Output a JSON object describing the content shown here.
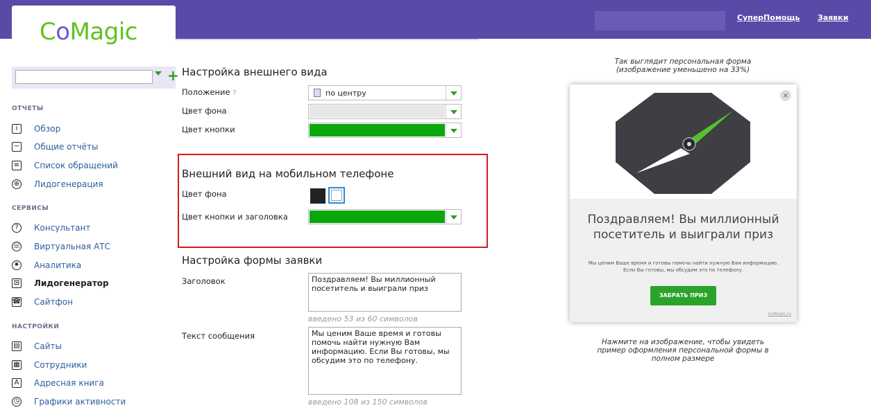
{
  "header": {
    "logo": "CoMagic",
    "links": {
      "help": "СуперПомощь",
      "apps": "Заявки",
      "more": ""
    }
  },
  "sidebar": {
    "search_value": "",
    "sections": [
      {
        "title": "ОТЧЕТЫ",
        "items": [
          "Обзор",
          "Общие отчёты",
          "Список обращений",
          "Лидогенерация"
        ]
      },
      {
        "title": "СЕРВИСЫ",
        "items": [
          "Консультант",
          "Виртуальная АТС",
          "Аналитика",
          "Лидогенератор",
          "Сайтфон"
        ]
      },
      {
        "title": "НАСТРОЙКИ",
        "items": [
          "Сайты",
          "Сотрудники",
          "Адресная книга",
          "Графики активности"
        ]
      }
    ],
    "active_item": "Лидогенератор"
  },
  "appearance": {
    "title": "Настройка внешнего вида",
    "position_label": "Положение",
    "position_value": "по центру",
    "bg_color_label": "Цвет фона",
    "button_color_label": "Цвет кнопки",
    "bg_color": "#e6e6e6",
    "button_color": "#0aa80a"
  },
  "mobile": {
    "title": "Внешний вид на мобильном телефоне",
    "bg_color_label": "Цвет фона",
    "button_title_color_label": "Цвет кнопки и заголовка",
    "swatch_dark": "#222222",
    "swatch_light": "#ffffff",
    "button_color": "#0aa80a"
  },
  "form": {
    "title": "Настройка формы заявки",
    "heading_label": "Заголовок",
    "heading_value": "Поздравляем! Вы миллионный посетитель и выиграли приз",
    "heading_counter": "введено 53 из 60 символов",
    "message_label": "Текст сообщения",
    "message_value": "Мы ценим Ваше время и готовы помочь найти нужную Вам информацию. Если Вы готовы, мы обсудим это по телефону.",
    "message_counter": "введено 108 из 150 символов"
  },
  "preview": {
    "caption": "Так выглядит персональная форма (изображение уменьшено на 33%)",
    "title": "Поздравляем! Вы миллионный посетитель и выиграли приз",
    "text": "Мы ценим Ваше время и готовы помочь найти нужную Вам информацию. Если Вы готовы, мы обсудим это по телефону.",
    "button": "ЗАБРАТЬ ПРИЗ",
    "brand": "CoMagic.ru",
    "note": "Нажмите на изображение, чтобы увидеть пример оформления персональной формы в полном размере"
  }
}
